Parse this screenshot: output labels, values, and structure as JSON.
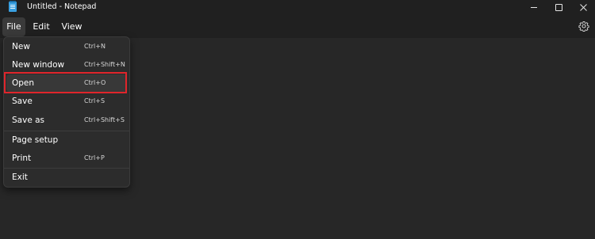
{
  "window": {
    "title": "Untitled - Notepad"
  },
  "menubar": {
    "file": "File",
    "edit": "Edit",
    "view": "View"
  },
  "file_menu": {
    "items": [
      {
        "label": "New",
        "shortcut": "Ctrl+N"
      },
      {
        "label": "New window",
        "shortcut": "Ctrl+Shift+N"
      },
      {
        "label": "Open",
        "shortcut": "Ctrl+O"
      },
      {
        "label": "Save",
        "shortcut": "Ctrl+S"
      },
      {
        "label": "Save as",
        "shortcut": "Ctrl+Shift+S"
      },
      {
        "label": "Page setup",
        "shortcut": ""
      },
      {
        "label": "Print",
        "shortcut": "Ctrl+P"
      },
      {
        "label": "Exit",
        "shortcut": ""
      }
    ],
    "highlighted_item": "Open"
  },
  "colors": {
    "background": "#272727",
    "menu_background": "#2c2c2c",
    "highlight_border": "#e0252b",
    "app_icon": "#3aa0e0"
  },
  "icons": {
    "app": "notepad-icon",
    "settings": "gear-icon",
    "minimize": "minimize-icon",
    "maximize": "maximize-icon",
    "close": "close-icon"
  }
}
